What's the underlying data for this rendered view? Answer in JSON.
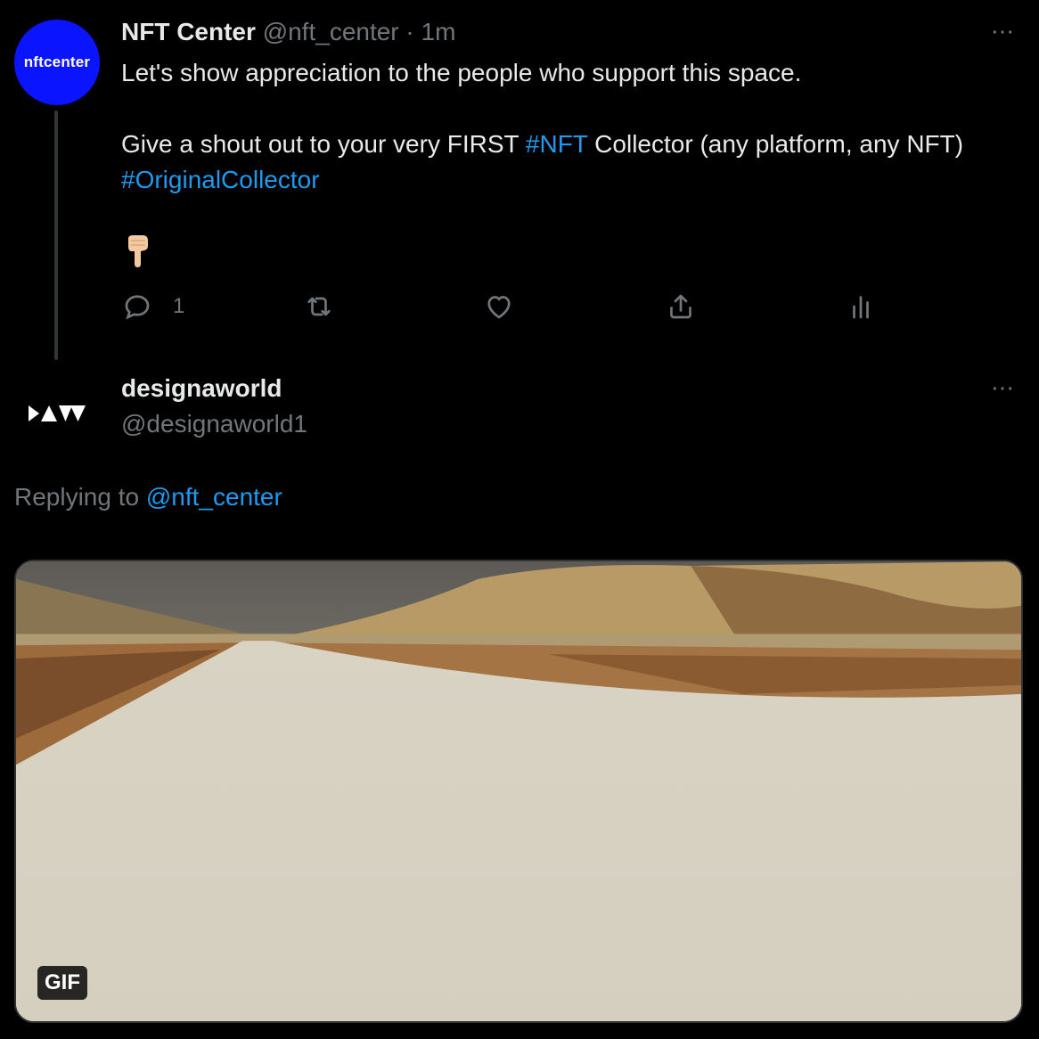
{
  "tweet": {
    "author_avatar_text": "nftcenter",
    "author_name": "NFT Center",
    "author_handle": "@nft_center",
    "separator": " · ",
    "time": "1m",
    "line1": "Let's show appreciation to the people who support this space.",
    "line2_prefix": "Give a shout out to your very FIRST ",
    "line2_hashtag": "#NFT",
    "line2_suffix": " Collector (any platform, any NFT)",
    "line3_hashtag": "#OriginalCollector",
    "emoji": "backhand-index-pointing-down",
    "reply_count": "1",
    "more_icon": "⋯"
  },
  "reply": {
    "author_name": "designaworld",
    "author_handle": "@designaworld1",
    "replying_label": "Replying to ",
    "replying_handle": "@nft_center",
    "media_badge": "GIF",
    "more_icon": "⋯"
  },
  "colors": {
    "background": "#000000",
    "text": "#e7e9ea",
    "secondary": "#71767b",
    "link": "#1d9bf0",
    "avatar_blue": "#0a14ff"
  }
}
